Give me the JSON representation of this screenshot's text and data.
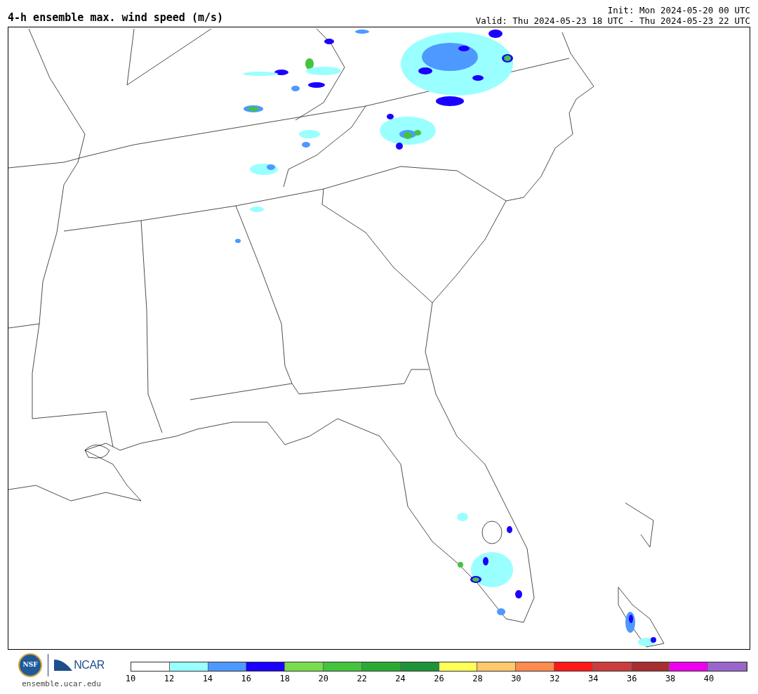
{
  "title": "4-h ensemble max. wind speed (m/s)",
  "init": "Init: Mon 2024-05-20 00 UTC",
  "valid": "Valid: Thu 2024-05-23 18 UTC - Thu 2024-05-23 22 UTC",
  "logos": {
    "nsf": "NSF",
    "ncar": "NCAR"
  },
  "site": "ensemble.ucar.edu",
  "colorbar": {
    "swatches": [
      {
        "color": "#ffffff"
      },
      {
        "color": "#99ffff"
      },
      {
        "color": "#4d99ff"
      },
      {
        "color": "#1a00ff"
      },
      {
        "color": "#77dd4d"
      },
      {
        "color": "#44c43c"
      },
      {
        "color": "#2aaa33"
      },
      {
        "color": "#1e9438"
      },
      {
        "color": "#ffff55"
      },
      {
        "color": "#ffc86a"
      },
      {
        "color": "#ff8a4d"
      },
      {
        "color": "#ff1a1a"
      },
      {
        "color": "#cc3d3d"
      },
      {
        "color": "#a62f2f"
      },
      {
        "color": "#ee00ee"
      },
      {
        "color": "#9966cc"
      }
    ],
    "ticks": [
      "10",
      "12",
      "14",
      "16",
      "18",
      "20",
      "22",
      "24",
      "26",
      "28",
      "30",
      "32",
      "34",
      "36",
      "38",
      "40"
    ]
  }
}
